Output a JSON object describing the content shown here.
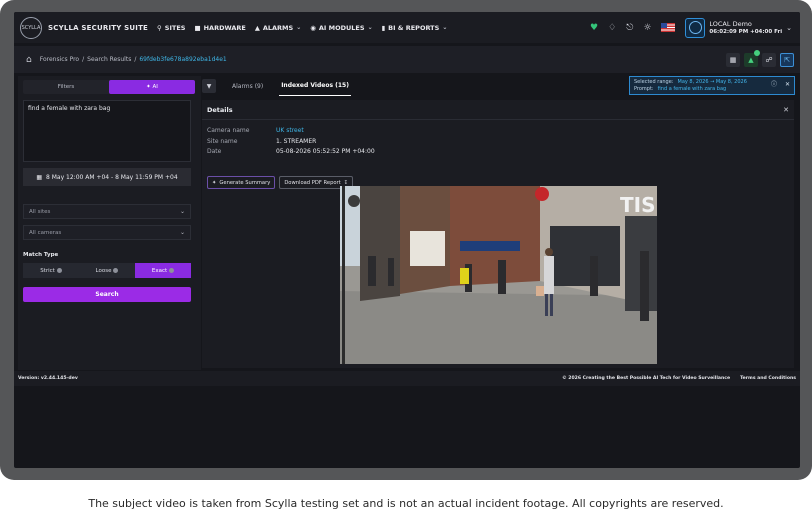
{
  "brand": {
    "logo_text": "SCYLLA",
    "name": "SCYLLA SECURITY SUITE"
  },
  "nav": {
    "items": [
      {
        "label": "SITES",
        "icon": "pin-icon",
        "has_menu": false
      },
      {
        "label": "HARDWARE",
        "icon": "car-icon",
        "has_menu": false
      },
      {
        "label": "ALARMS",
        "icon": "bell-icon",
        "has_menu": true
      },
      {
        "label": "AI MODULES",
        "icon": "ai-icon",
        "has_menu": true
      },
      {
        "label": "BI & REPORTS",
        "icon": "chart-icon",
        "has_menu": true
      }
    ]
  },
  "user": {
    "name": "LOCAL Demo",
    "datetime": "06:02:09 PM +04:00 Fri"
  },
  "breadcrumb": {
    "items": [
      "Forensics Pro",
      "Search Results"
    ],
    "current": "69fdeb3fe678a892eba1d4e1"
  },
  "left": {
    "tabs": {
      "filters": "Filters",
      "ai": "AI"
    },
    "query": "find a female with zara bag",
    "date_range": "8 May 12:00 AM +04 - 8 May 11:59 PM +04",
    "sites_placeholder": "All sites",
    "cameras_placeholder": "All cameras",
    "match_type_label": "Match Type",
    "match_options": [
      "Strict",
      "Loose",
      "Exact"
    ],
    "match_selected": "Exact",
    "search_label": "Search"
  },
  "tabs": {
    "alarms": "Alarms (9)",
    "indexed": "Indexed Videos (15)"
  },
  "range_box": {
    "selected_label": "Selected range:",
    "selected_value": "May 8, 2026 → May 8, 2026",
    "prompt_label": "Prompt:",
    "prompt_value": "find a female with zara bag"
  },
  "details": {
    "title": "Details",
    "rows": [
      {
        "key": "Camera name",
        "value": "UK street"
      },
      {
        "key": "Site name",
        "value": "1. STREAMER"
      },
      {
        "key": "Date",
        "value": "05-08-2026 05:52:52 PM +04:00"
      }
    ],
    "generate_label": "Generate Summary",
    "download_label": "Download PDF Report"
  },
  "scene_text": {
    "shop_sign": "TIS"
  },
  "footer": {
    "version": "Version: v2.44.145-dev",
    "copyright": "© 2026 Creating the Best Possible AI Tech for Video Surveillance",
    "terms": "Terms and Conditions"
  },
  "disclaimer": "The subject video is taken from Scylla testing set and is not an actual incident footage. All copyrights are reserved.",
  "colors": {
    "accent_purple": "#8a2be2",
    "link_blue": "#3fb7e8",
    "status_green": "#34c57a"
  }
}
